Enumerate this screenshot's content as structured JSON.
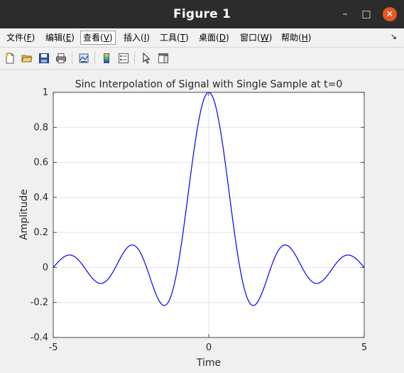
{
  "window": {
    "title": "Figure 1",
    "controls": {
      "minimize": "–",
      "maximize": "□",
      "close": "✕"
    }
  },
  "menu": {
    "items": [
      {
        "label": "文件(",
        "key": "F",
        "tail": ")"
      },
      {
        "label": "编辑(",
        "key": "E",
        "tail": ")"
      },
      {
        "label": "查看(",
        "key": "V",
        "tail": ")"
      },
      {
        "label": "插入(",
        "key": "I",
        "tail": ")"
      },
      {
        "label": "工具(",
        "key": "T",
        "tail": ")"
      },
      {
        "label": "桌面(",
        "key": "D",
        "tail": ")"
      },
      {
        "label": "窗口(",
        "key": "W",
        "tail": ")"
      },
      {
        "label": "帮助(",
        "key": "H",
        "tail": ")"
      }
    ],
    "active_index": 2,
    "dock_arrow": "↘"
  },
  "toolbar": {
    "icons": [
      "new-figure-icon",
      "open-folder-icon",
      "save-icon",
      "print-icon",
      "link-plot-icon",
      "colorbar-icon",
      "legend-icon",
      "pointer-icon",
      "property-editor-icon"
    ]
  },
  "chart_data": {
    "type": "line",
    "title": "Sinc Interpolation of Signal with Single Sample at t=0",
    "xlabel": "Time",
    "ylabel": "Amplitude",
    "xlim": [
      -5,
      5
    ],
    "ylim": [
      -0.4,
      1
    ],
    "xticks": [
      -5,
      0,
      5
    ],
    "xtick_labels": [
      "-5",
      "0",
      "5"
    ],
    "yticks": [
      -0.4,
      -0.2,
      0,
      0.2,
      0.4,
      0.6,
      0.8,
      1
    ],
    "ytick_labels": [
      "-0.4",
      "-0.2",
      "0",
      "0.2",
      "0.4",
      "0.6",
      "0.8",
      "1"
    ],
    "grid": true,
    "function": "sinc(t) = sin(pi t)/(pi t)",
    "series": [
      {
        "color": "#0000ff",
        "x": [
          -5,
          -4.5,
          -4,
          -3.5,
          -3,
          -2.5,
          -2,
          -1.5,
          -1,
          -0.5,
          0,
          0.5,
          1,
          1.5,
          2,
          2.5,
          3,
          3.5,
          4,
          4.5,
          5
        ],
        "y": [
          0,
          0.0707,
          0,
          -0.0909,
          0,
          0.1273,
          0,
          -0.2122,
          0,
          0.6366,
          1,
          0.6366,
          0,
          -0.2122,
          0,
          0.1273,
          0,
          -0.0909,
          0,
          0.0707,
          0
        ]
      }
    ]
  }
}
